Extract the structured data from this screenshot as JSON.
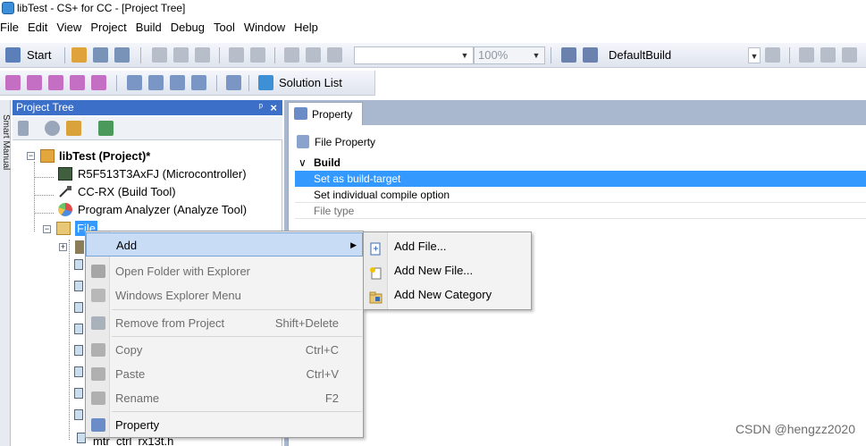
{
  "window": {
    "title": "libTest - CS+ for CC - [Project Tree]"
  },
  "menubar": {
    "items": [
      "File",
      "Edit",
      "View",
      "Project",
      "Build",
      "Debug",
      "Tool",
      "Window",
      "Help"
    ]
  },
  "toolbar": {
    "start_label": "Start",
    "zoom_value": "100%",
    "build_config_value": "DefaultBuild"
  },
  "toolbar2": {
    "solution_list_label": "Solution List"
  },
  "smart_manual": {
    "label": "Smart Manual"
  },
  "project_tree": {
    "title": "Project Tree",
    "pin_glyph": "ᵖ",
    "close_glyph": "×",
    "project_label": "libTest (Project)*",
    "children": [
      {
        "label": "R5F513T3AxFJ (Microcontroller)",
        "icon": "microcontroller-icon"
      },
      {
        "label": "CC-RX (Build Tool)",
        "icon": "build-tool-icon"
      },
      {
        "label": "Program Analyzer (Analyze Tool)",
        "icon": "analyzer-icon"
      }
    ],
    "file_folder_label": "File",
    "bottom_file_label": "mtr_ctrl_rx13t.h"
  },
  "property_panel": {
    "tab_label": "Property",
    "header_label": "File Property",
    "category_label": "Build",
    "rows": [
      "Set as build-target",
      "Set individual compile option",
      "File type"
    ]
  },
  "context_menu": {
    "items": [
      {
        "label": "Add",
        "shortcut": "",
        "enabled": true,
        "has_submenu": true,
        "icon": ""
      },
      {
        "label": "Open Folder with Explorer",
        "shortcut": "",
        "enabled": false,
        "icon": "folder-open-icon"
      },
      {
        "label": "Windows Explorer Menu",
        "shortcut": "",
        "enabled": false,
        "icon": "explorer-menu-icon"
      },
      {
        "label": "Remove from Project",
        "shortcut": "Shift+Delete",
        "enabled": false,
        "icon": "remove-icon"
      },
      {
        "label": "Copy",
        "shortcut": "Ctrl+C",
        "enabled": false,
        "icon": "copy-icon"
      },
      {
        "label": "Paste",
        "shortcut": "Ctrl+V",
        "enabled": false,
        "icon": "paste-icon"
      },
      {
        "label": "Rename",
        "shortcut": "F2",
        "enabled": false,
        "icon": "rename-icon"
      },
      {
        "label": "Property",
        "shortcut": "",
        "enabled": true,
        "icon": "property-icon"
      }
    ]
  },
  "submenu": {
    "items": [
      {
        "label": "Add File...",
        "icon": "add-file-icon"
      },
      {
        "label": "Add New File...",
        "icon": "add-new-file-icon"
      },
      {
        "label": "Add New Category",
        "icon": "add-category-icon"
      }
    ]
  },
  "watermark": {
    "text": "CSDN @hengzz2020"
  },
  "colors": {
    "selection_blue": "#3399ff",
    "panel_header_blue": "#3c70c8",
    "menu_highlight": "#c9dcf5",
    "disabled_text": "#6d6d6d"
  }
}
